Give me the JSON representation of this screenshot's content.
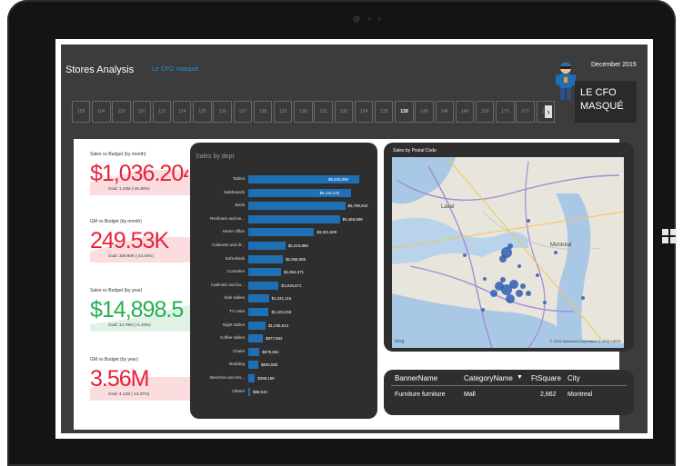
{
  "report": {
    "title": "Stores Analysis",
    "subtitle": "Le CFO masqué",
    "date": "December 2015",
    "logo_line1": "LE CFO",
    "logo_line2": "MASQUÉ"
  },
  "store_slicer": {
    "items": [
      "103",
      "104",
      "119",
      "120",
      "122",
      "124",
      "125",
      "126",
      "127",
      "128",
      "129",
      "130",
      "131",
      "132",
      "134",
      "135",
      "139",
      "145",
      "146",
      "148",
      "159",
      "170",
      "171",
      "172"
    ],
    "selected": "139",
    "next_arrow": "›"
  },
  "kpis": [
    {
      "label": "Sales vs Budget (by month)",
      "value": "$1,036.204",
      "goal": "Goal: 1.24M (-16.36%)",
      "color": "#e8223a",
      "status": "below"
    },
    {
      "label": "GM vs Budget (by month)",
      "value": "249.53K",
      "goal": "Goal: 329.80K (-24.34%)",
      "color": "#e8223a",
      "status": "below"
    },
    {
      "label": "Sales vs Budget (by year)",
      "value": "$14,898.5",
      "goal": "Goal: 14.70M (+1.34%)",
      "color": "#22b24c",
      "status": "above"
    },
    {
      "label": "GM vs Budget (by year)",
      "value": "3.56M",
      "goal": "Goal: 4.11M (-13.37%)",
      "color": "#e8223a",
      "status": "below"
    }
  ],
  "sales_by_dept": {
    "title": "Sales by dept",
    "chart_data": {
      "type": "bar",
      "orientation": "horizontal",
      "title": "Sales by dept",
      "categories": [
        "Tables",
        "Sideboards",
        "Beds",
        "Recliners and se...",
        "Home office",
        "Cabinets and dr...",
        "Sofa-Beds",
        "Consoles",
        "Cabinets and bo...",
        "Side tables",
        "TV units",
        "Night tables",
        "Coffee tables",
        "Chairs",
        "Bedding",
        "Benches and sto...",
        "Others"
      ],
      "values": [
        6630096,
        6119220,
        5788942,
        5469959,
        3931609,
        2219888,
        2069086,
        1964371,
        1816671,
        1231116,
        1222216,
        1035613,
        877952,
        675651,
        600683,
        398159,
        86510
      ],
      "labels": [
        "$6,630,096",
        "$6,119,220",
        "$5,788,942",
        "$5,469,959",
        "$3,931,609",
        "$2,219,888",
        "$2,069,086",
        "$1,964,371",
        "$1,816,671",
        "$1,231,116",
        "$1,222,216",
        "$1,035,613",
        "$877,952",
        "$675,651",
        "$600,683",
        "$398,159",
        "$86,510"
      ],
      "bar_color": "#1f6fb5"
    }
  },
  "map": {
    "title": "Sales by Postal Code",
    "attribution": "© 2016 Microsoft Corporation  © 2016 HERE",
    "brand": "bing",
    "places": [
      "Laval",
      "Montréal"
    ]
  },
  "table": {
    "columns": [
      "BannerName",
      "CategoryName",
      "FtSquare",
      "City"
    ],
    "sort_icon": "▼",
    "rows": [
      [
        "Furniture furniture",
        "Mall",
        "2,662",
        "Montreal"
      ]
    ]
  },
  "colors": {
    "accent": "#2b8fd6",
    "bar": "#1f6fb5",
    "negative": "#e8223a",
    "positive": "#22b24c",
    "panel": "#2e2e2e",
    "background": "#3c3c3c"
  }
}
